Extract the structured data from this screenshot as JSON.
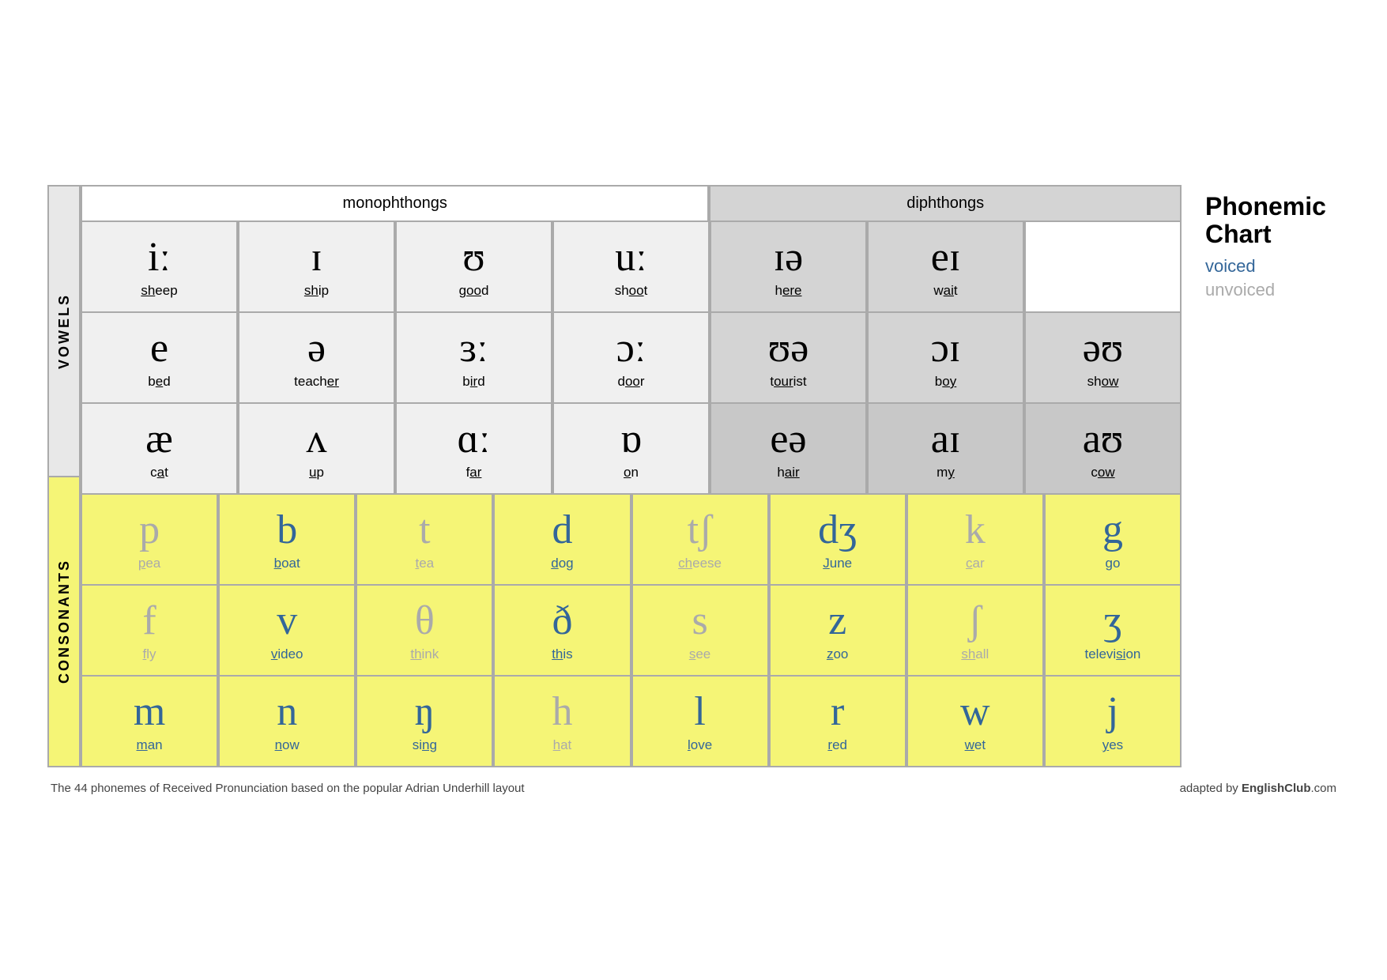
{
  "title": "Phonemic Chart",
  "legend": {
    "title": "Phonemic\nChart",
    "voiced": "voiced",
    "unvoiced": "unvoiced"
  },
  "header": {
    "monophthongs": "monophthongs",
    "diphthongs": "diphthongs"
  },
  "labels": {
    "vowels": "VOWELS",
    "consonants": "CONSONANTS"
  },
  "vowel_rows": [
    [
      {
        "symbol": "iː",
        "word": "sheep",
        "underline": "sh"
      },
      {
        "symbol": "ɪ",
        "word": "ship",
        "underline": "sh"
      },
      {
        "symbol": "ʊ",
        "word": "good",
        "underline": "oo"
      },
      {
        "symbol": "uː",
        "word": "shoot",
        "underline": "oo"
      },
      {
        "symbol": "ɪə",
        "word": "here",
        "underline": "ere"
      },
      {
        "symbol": "eɪ",
        "word": "wait",
        "underline": "ai"
      }
    ],
    [
      {
        "symbol": "e",
        "word": "bed",
        "underline": "e"
      },
      {
        "symbol": "ə",
        "word": "teacher",
        "underline": "er"
      },
      {
        "symbol": "ɜː",
        "word": "bird",
        "underline": "ir"
      },
      {
        "symbol": "ɔː",
        "word": "door",
        "underline": "oo"
      },
      {
        "symbol": "ʊə",
        "word": "tourist",
        "underline": "our"
      },
      {
        "symbol": "ɔɪ",
        "word": "boy",
        "underline": "oy"
      },
      {
        "symbol": "əʊ",
        "word": "show",
        "underline": "ow"
      }
    ],
    [
      {
        "symbol": "æ",
        "word": "cat",
        "underline": "a"
      },
      {
        "symbol": "ʌ",
        "word": "up",
        "underline": "u"
      },
      {
        "symbol": "ɑː",
        "word": "far",
        "underline": "ar"
      },
      {
        "symbol": "ɒ",
        "word": "on",
        "underline": "o"
      },
      {
        "symbol": "eə",
        "word": "hair",
        "underline": "air"
      },
      {
        "symbol": "aɪ",
        "word": "my",
        "underline": "y"
      },
      {
        "symbol": "aʊ",
        "word": "cow",
        "underline": "ow"
      }
    ]
  ],
  "consonant_rows": [
    [
      {
        "symbol": "p",
        "word": "pea",
        "underline": "p",
        "voiced": false
      },
      {
        "symbol": "b",
        "word": "boat",
        "underline": "b",
        "voiced": true
      },
      {
        "symbol": "t",
        "word": "tea",
        "underline": "t",
        "voiced": false
      },
      {
        "symbol": "d",
        "word": "dog",
        "underline": "d",
        "voiced": true
      },
      {
        "symbol": "tʃ",
        "word": "cheese",
        "underline": "ch",
        "voiced": false
      },
      {
        "symbol": "dʒ",
        "word": "June",
        "underline": "J",
        "voiced": true
      },
      {
        "symbol": "k",
        "word": "car",
        "underline": "c",
        "voiced": false
      },
      {
        "symbol": "g",
        "word": "go",
        "underline": "g",
        "voiced": true
      }
    ],
    [
      {
        "symbol": "f",
        "word": "fly",
        "underline": "f",
        "voiced": false
      },
      {
        "symbol": "v",
        "word": "video",
        "underline": "v",
        "voiced": true
      },
      {
        "symbol": "θ",
        "word": "think",
        "underline": "th",
        "voiced": false
      },
      {
        "symbol": "ð",
        "word": "this",
        "underline": "th",
        "voiced": true
      },
      {
        "symbol": "s",
        "word": "see",
        "underline": "s",
        "voiced": false
      },
      {
        "symbol": "z",
        "word": "zoo",
        "underline": "z",
        "voiced": true
      },
      {
        "symbol": "ʃ",
        "word": "shall",
        "underline": "sh",
        "voiced": false
      },
      {
        "symbol": "ʒ",
        "word": "television",
        "underline": "si",
        "voiced": true
      }
    ],
    [
      {
        "symbol": "m",
        "word": "man",
        "underline": "m",
        "voiced": true
      },
      {
        "symbol": "n",
        "word": "now",
        "underline": "n",
        "voiced": true
      },
      {
        "symbol": "ŋ",
        "word": "sing",
        "underline": "ng",
        "voiced": true
      },
      {
        "symbol": "h",
        "word": "hat",
        "underline": "h",
        "voiced": false
      },
      {
        "symbol": "l",
        "word": "love",
        "underline": "l",
        "voiced": true
      },
      {
        "symbol": "r",
        "word": "red",
        "underline": "r",
        "voiced": true
      },
      {
        "symbol": "w",
        "word": "wet",
        "underline": "w",
        "voiced": true
      },
      {
        "symbol": "j",
        "word": "yes",
        "underline": "y",
        "voiced": true
      }
    ]
  ],
  "footer": {
    "note": "The 44 phonemes of Received Pronunciation based on the popular Adrian Underhill layout",
    "credit_prefix": "adapted by ",
    "credit_brand": "EnglishClub",
    "credit_suffix": ".com"
  }
}
